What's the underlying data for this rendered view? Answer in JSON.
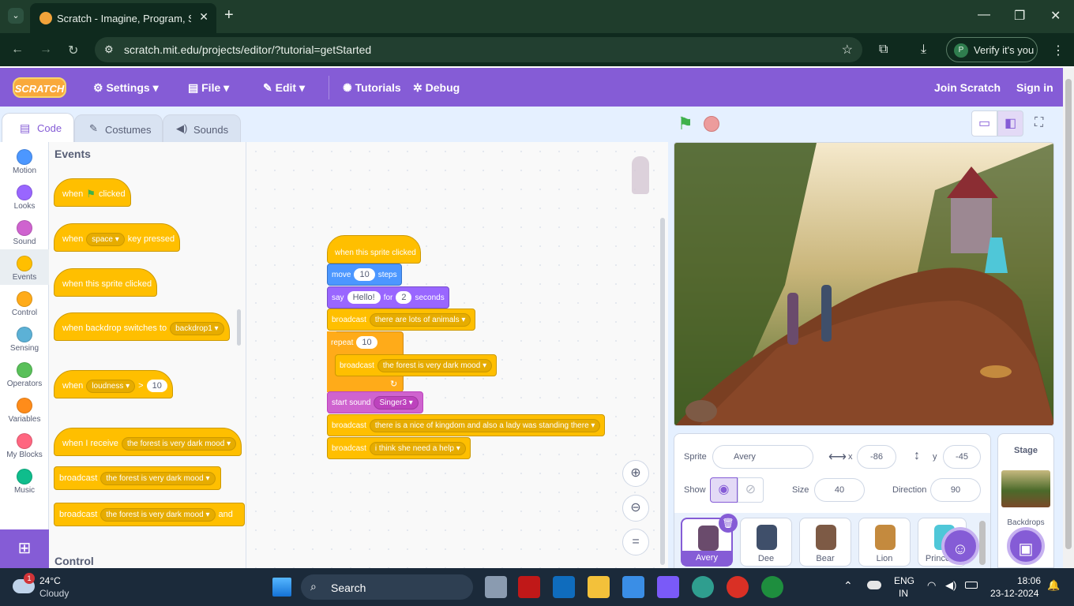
{
  "browser": {
    "tab_title": "Scratch - Imagine, Program, Share",
    "url": "scratch.mit.edu/projects/editor/?tutorial=getStarted",
    "profile_initial": "P",
    "verify_label": "Verify it's you"
  },
  "menu": {
    "logo": "SCRATCH",
    "settings": "Settings",
    "file": "File",
    "edit": "Edit",
    "tutorials": "Tutorials",
    "debug": "Debug",
    "join": "Join Scratch",
    "signin": "Sign in"
  },
  "tabs": {
    "code": "Code",
    "costumes": "Costumes",
    "sounds": "Sounds"
  },
  "categories": [
    {
      "label": "Motion",
      "color": "#4c97ff"
    },
    {
      "label": "Looks",
      "color": "#9966ff"
    },
    {
      "label": "Sound",
      "color": "#cf63cf"
    },
    {
      "label": "Events",
      "color": "#ffbf00"
    },
    {
      "label": "Control",
      "color": "#ffab19"
    },
    {
      "label": "Sensing",
      "color": "#5cb1d6"
    },
    {
      "label": "Operators",
      "color": "#59c059"
    },
    {
      "label": "Variables",
      "color": "#ff8c1a"
    },
    {
      "label": "My Blocks",
      "color": "#ff6680"
    },
    {
      "label": "Music",
      "color": "#0fbd8c"
    }
  ],
  "palette": {
    "heading": "Events",
    "control_heading": "Control",
    "b1_when": "when",
    "b1_clicked": "clicked",
    "b2_when": "when",
    "b2_key": "space",
    "b2_pressed": "key pressed",
    "b3": "when this sprite clicked",
    "b4": "when backdrop switches to",
    "b4_dd": "backdrop1",
    "b5_when": "when",
    "b5_dd": "loudness",
    "b5_op": ">",
    "b5_val": "10",
    "b6": "when I receive",
    "b6_dd": "the forest is very dark mood",
    "b7": "broadcast",
    "b7_dd": "the forest is very dark mood",
    "b8": "broadcast",
    "b8_dd": "the forest is very dark mood",
    "b8_tail": "and"
  },
  "script": {
    "hat": "when this sprite clicked",
    "move": "move",
    "move_val": "10",
    "move_unit": "steps",
    "say": "say",
    "say_val": "Hello!",
    "say_for": "for",
    "say_secs": "2",
    "say_unit": "seconds",
    "bc1": "broadcast",
    "bc1_dd": "there are lots of animals",
    "repeat": "repeat",
    "repeat_val": "10",
    "bc2": "broadcast",
    "bc2_dd": "the forest is very dark mood",
    "sound": "start sound",
    "sound_dd": "Singer3",
    "bc3": "broadcast",
    "bc3_dd": "there is a nice of kingdom and also a lady was standing there",
    "bc4": "broadcast",
    "bc4_dd": "i think she need a help"
  },
  "sprite_info": {
    "sprite_label": "Sprite",
    "name": "Avery",
    "x_label": "x",
    "x": "-86",
    "y_label": "y",
    "y": "-45",
    "show_label": "Show",
    "size_label": "Size",
    "size": "40",
    "direction_label": "Direction",
    "direction": "90"
  },
  "sprites": [
    "Avery",
    "Dee",
    "Bear",
    "Lion",
    "Princess"
  ],
  "stage_pane": {
    "title": "Stage",
    "backdrops": "Backdrops"
  },
  "taskbar": {
    "temp": "24°C",
    "weather": "Cloudy",
    "badge": "1",
    "search": "Search",
    "lang": "ENG",
    "region": "IN",
    "time": "18:06",
    "date": "23-12-2024"
  }
}
